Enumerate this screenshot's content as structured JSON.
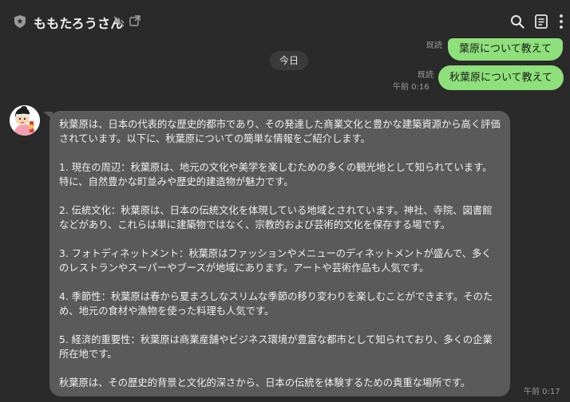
{
  "header": {
    "title": "ももたろうさん",
    "icons": [
      "shield-icon",
      "mute-icon",
      "popout-icon",
      "search-icon",
      "notes-icon",
      "more-icon"
    ]
  },
  "chat": {
    "date_divider": "今日",
    "outgoing": [
      {
        "text": "葉原について教えて",
        "read": "既読",
        "time": ""
      },
      {
        "text": "秋葉原について教えて",
        "read": "既読",
        "time": "午前 0:16"
      }
    ],
    "incoming": {
      "paragraphs": [
        "秋葉原は、日本の代表的な歴史的都市であり、その発達した商業文化と豊かな建築資源から高く評価されています。以下に、秋葉原についての簡単な情報をご紹介します。",
        "1. 現在の周辺：秋葉原は、地元の文化や美学を楽しむための多くの観光地として知られています。特に、自然豊かな町並みや歴史的建造物が魅力です。",
        "2. 伝統文化：秋葉原は、日本の伝統文化を体現している地域とされています。神社、寺院、図書館などがあり、これらは単に建築物ではなく、宗教的および芸術的文化を保存する場です。",
        "3. フォトディネットメント：秋葉原はファッションやメニューのディネットメントが盛んで、多くのレストランやスーパーやブースが地域にあります。アートや芸術作品も人気です。",
        "4. 季節性：秋葉原は春から夏まろしなスリムな季節の移り変わりを楽しむことができます。そのため、地元の食材や漁物を使った料理も人気です。",
        "5. 経済的重要性：秋葉原は商業産舗やビジネス環境が豊富な都市として知られており、多くの企業所在地です。",
        "秋葉原は、その歴史的背景と文化的深さから、日本の伝統を体験するための貴重な場所です。"
      ],
      "time": "午前 0:17"
    }
  },
  "colors": {
    "background": "#2a2a2a",
    "outgoing_bubble": "#8ee07a",
    "incoming_bubble": "#5a5a5a",
    "date_pill": "#3b3b3b"
  }
}
